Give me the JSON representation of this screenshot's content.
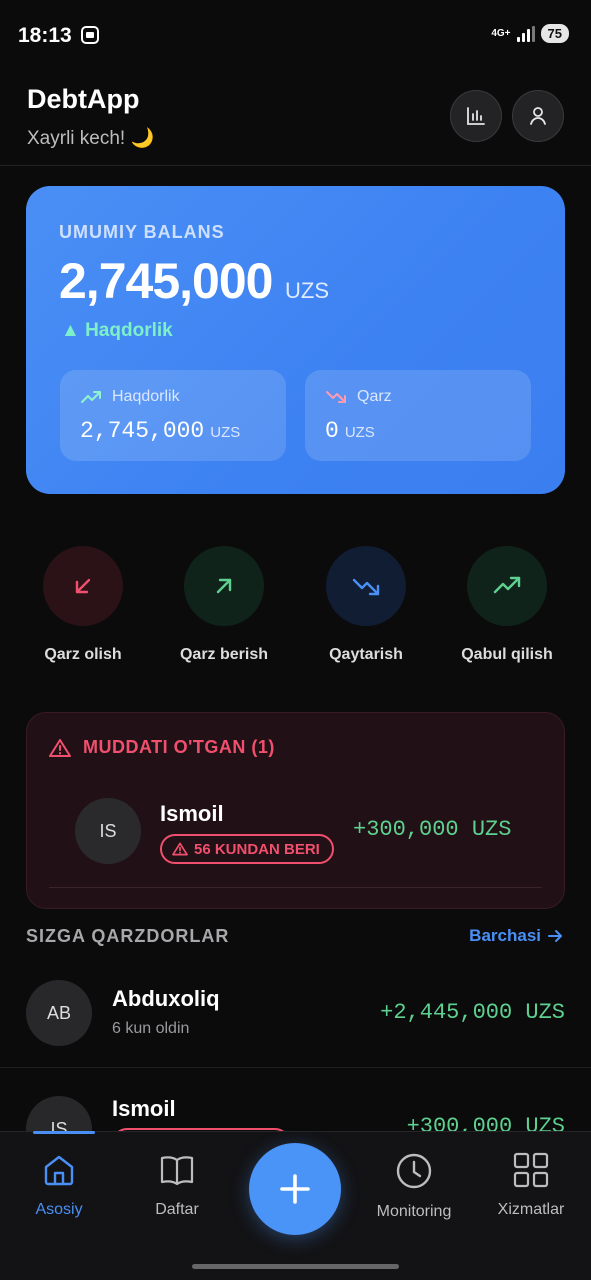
{
  "status_bar": {
    "time": "18:13",
    "network": "4G+",
    "battery": "75"
  },
  "header": {
    "title": "DebtApp",
    "greeting": "Xayrli kech! 🌙",
    "icons": [
      "bar-chart-icon",
      "user-icon"
    ]
  },
  "balance_card": {
    "label": "UMUMIY BALANS",
    "amount": "2,745,000",
    "currency": "UZS",
    "status": "▲ Haqdorlik",
    "receivable": {
      "label": "Haqdorlik",
      "value": "2,745,000",
      "currency": "UZS"
    },
    "debt": {
      "label": "Qarz",
      "value": "0",
      "currency": "UZS"
    }
  },
  "quick_actions": [
    {
      "label": "Qarz olish",
      "icon": "arrow-down-left-icon",
      "color": "#f0506e"
    },
    {
      "label": "Qarz berish",
      "icon": "arrow-up-right-icon",
      "color": "#5ed08f"
    },
    {
      "label": "Qaytarish",
      "icon": "trending-down-icon",
      "color": "#4a8ff5"
    },
    {
      "label": "Qabul qilish",
      "icon": "trending-up-icon",
      "color": "#5ed08f"
    }
  ],
  "overdue": {
    "title": "MUDDATI O'TGAN (1)",
    "item": {
      "initials": "IS",
      "name": "Ismoil",
      "badge": "56 KUNDAN BERI",
      "amount": "+300,000 UZS"
    }
  },
  "debtors": {
    "title": "SIZGA QARZDORLAR",
    "link": "Barchasi",
    "rows": [
      {
        "initials": "AB",
        "name": "Abduxoliq",
        "sub": "6 kun oldin",
        "amount": "+2,445,000 UZS"
      },
      {
        "initials": "IS",
        "name": "Ismoil",
        "amount": "+300,000 UZS"
      }
    ]
  },
  "bottom_nav": {
    "items": [
      {
        "label": "Asosiy",
        "icon": "home-icon",
        "active": true
      },
      {
        "label": "Daftar",
        "icon": "book-icon",
        "active": false
      },
      {
        "label": "Monitoring",
        "icon": "clock-icon",
        "active": false
      },
      {
        "label": "Xizmatlar",
        "icon": "grid-icon",
        "active": false
      }
    ],
    "fab_icon": "plus-icon"
  },
  "colors": {
    "accent": "#4a8ff5",
    "positive": "#5ed08f",
    "negative": "#f0506e",
    "background": "#0b0b0c"
  }
}
